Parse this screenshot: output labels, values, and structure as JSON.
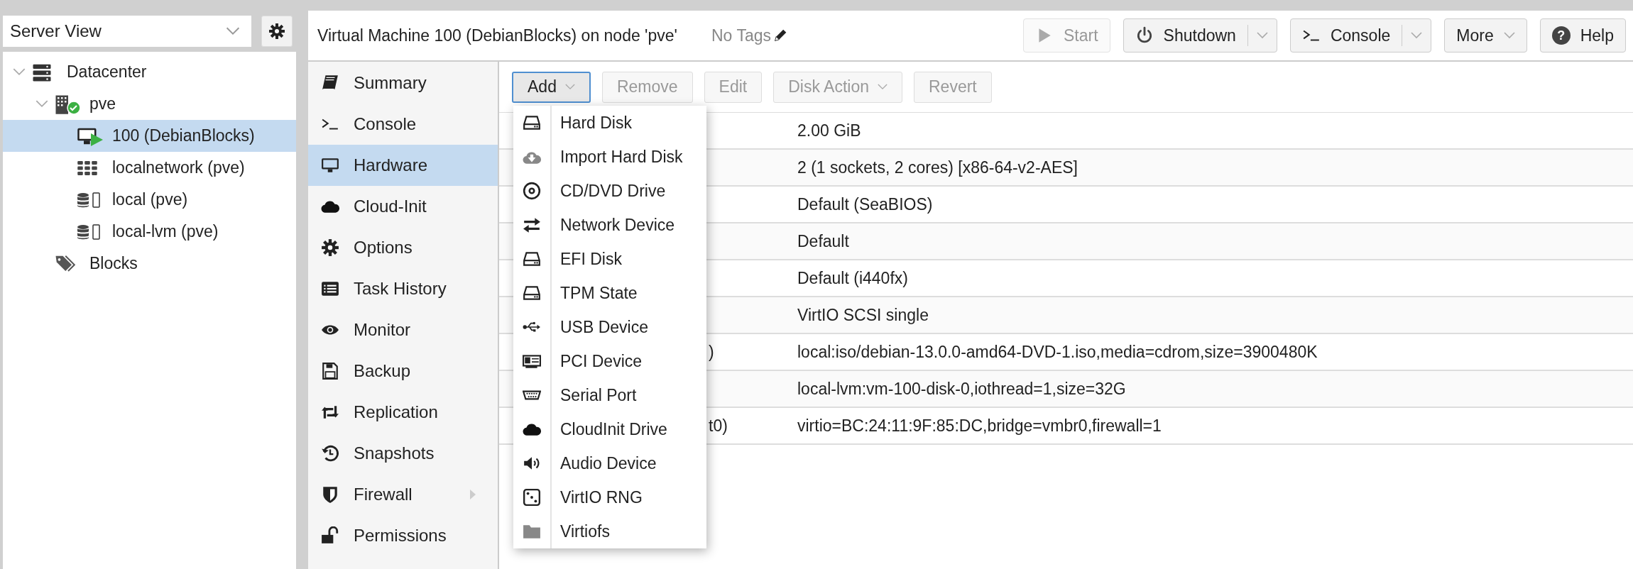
{
  "view_selector": {
    "value": "Server View"
  },
  "tree": [
    {
      "label": "Datacenter",
      "kind": "datacenter",
      "expanded": true,
      "selected": false,
      "children": [
        {
          "label": "pve",
          "kind": "node",
          "online": true,
          "expanded": true,
          "selected": false,
          "children": [
            {
              "label": "100 (DebianBlocks)",
              "kind": "vm",
              "running": true,
              "selected": true
            },
            {
              "label": "localnetwork (pve)",
              "kind": "network",
              "selected": false
            },
            {
              "label": "local (pve)",
              "kind": "storage",
              "selected": false
            },
            {
              "label": "local-lvm (pve)",
              "kind": "storage",
              "selected": false
            }
          ]
        },
        {
          "label": "Blocks",
          "kind": "tag",
          "selected": false
        }
      ]
    }
  ],
  "header": {
    "title": "Virtual Machine 100 (DebianBlocks) on node 'pve'",
    "tags": "No Tags",
    "buttons": [
      {
        "label": "Start",
        "kind": "play",
        "disabled": true
      },
      {
        "label": "Shutdown",
        "kind": "power",
        "disabled": false,
        "split": true
      },
      {
        "label": "Console",
        "kind": "terminal",
        "disabled": false,
        "split": true
      },
      {
        "label": "More",
        "disabled": false,
        "dropdown": true
      },
      {
        "label": "Help",
        "glyph": "?",
        "disabled": false
      }
    ]
  },
  "nav": [
    {
      "label": "Summary",
      "kind": "book",
      "selected": false
    },
    {
      "label": "Console",
      "kind": "terminal",
      "selected": false
    },
    {
      "label": "Hardware",
      "kind": "monitor",
      "selected": true
    },
    {
      "label": "Cloud-Init",
      "kind": "cloud",
      "selected": false
    },
    {
      "label": "Options",
      "kind": "gear",
      "selected": false
    },
    {
      "label": "Task History",
      "kind": "list",
      "selected": false
    },
    {
      "label": "Monitor",
      "kind": "eye",
      "selected": false
    },
    {
      "label": "Backup",
      "kind": "floppy",
      "selected": false
    },
    {
      "label": "Replication",
      "kind": "retweet",
      "selected": false
    },
    {
      "label": "Snapshots",
      "kind": "history",
      "selected": false
    },
    {
      "label": "Firewall",
      "kind": "shield",
      "selected": false,
      "expandable": true
    },
    {
      "label": "Permissions",
      "kind": "unlock",
      "selected": false
    }
  ],
  "toolbar": [
    {
      "label": "Add",
      "disabled": false,
      "pressed": true,
      "dropdown": true
    },
    {
      "label": "Remove",
      "disabled": true,
      "pressed": false
    },
    {
      "label": "Edit",
      "disabled": true,
      "pressed": false
    },
    {
      "label": "Disk Action",
      "disabled": true,
      "pressed": false,
      "dropdown": true
    },
    {
      "label": "Revert",
      "disabled": true,
      "pressed": false
    }
  ],
  "hardware_rows": [
    {
      "value": "2.00 GiB"
    },
    {
      "value": "2 (1 sockets, 2 cores) [x86-64-v2-AES]"
    },
    {
      "value": "Default (SeaBIOS)"
    },
    {
      "value": "Default"
    },
    {
      "value": "Default (i440fx)"
    },
    {
      "value": "VirtIO SCSI single"
    },
    {
      "key": ")",
      "value": "local:iso/debian-13.0.0-amd64-DVD-1.iso,media=cdrom,size=3900480K"
    },
    {
      "value": "local-lvm:vm-100-disk-0,iothread=1,size=32G"
    },
    {
      "key": "t0)",
      "value": "virtio=BC:24:11:9F:85:DC,bridge=vmbr0,firewall=1"
    }
  ],
  "add_menu": [
    {
      "label": "Hard Disk",
      "kind": "hdd"
    },
    {
      "label": "Import Hard Disk",
      "kind": "cloud-download"
    },
    {
      "label": "CD/DVD Drive",
      "kind": "disc"
    },
    {
      "label": "Network Device",
      "kind": "exchange"
    },
    {
      "label": "EFI Disk",
      "kind": "hdd"
    },
    {
      "label": "TPM State",
      "kind": "hdd"
    },
    {
      "label": "USB Device",
      "kind": "usb"
    },
    {
      "label": "PCI Device",
      "kind": "card"
    },
    {
      "label": "Serial Port",
      "kind": "serial"
    },
    {
      "label": "CloudInit Drive",
      "kind": "cloud"
    },
    {
      "label": "Audio Device",
      "kind": "volume"
    },
    {
      "label": "VirtIO RNG",
      "kind": "dice"
    },
    {
      "label": "Virtiofs",
      "kind": "folder"
    }
  ]
}
